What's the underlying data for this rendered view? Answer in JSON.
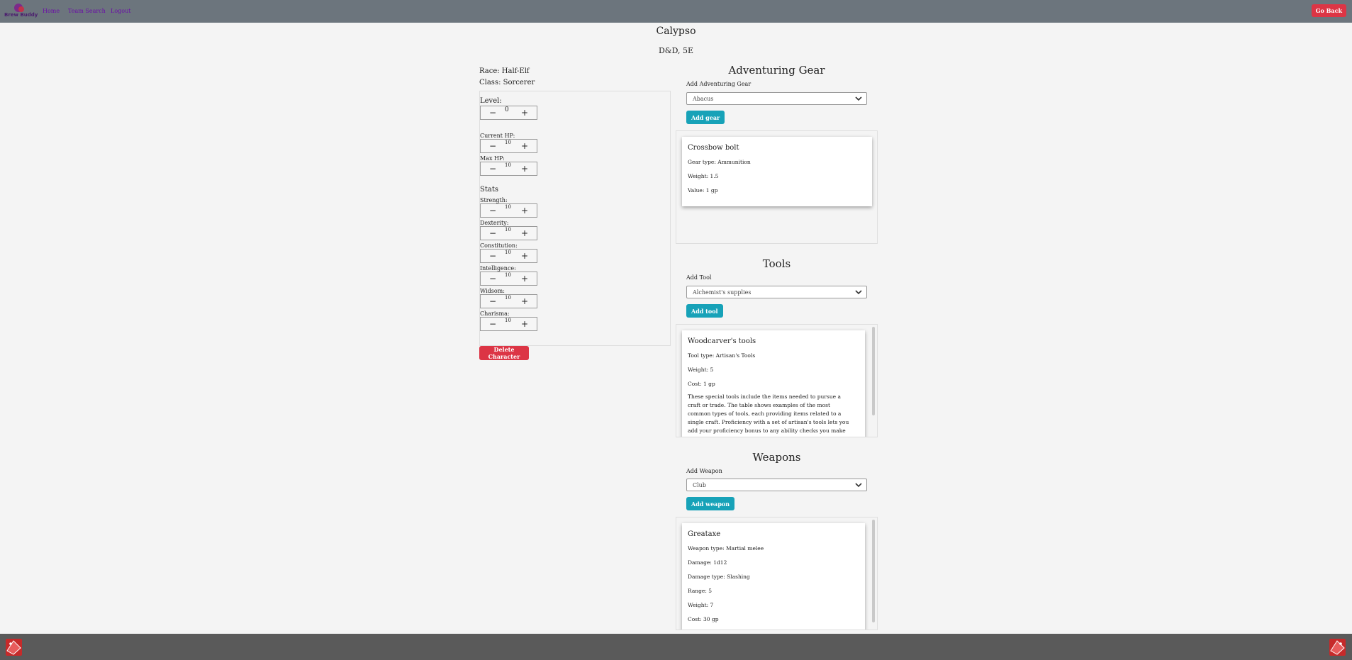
{
  "nav": {
    "logo_text": "Brew Buddy",
    "links": [
      "Home",
      "Team Search",
      "Logout"
    ],
    "go_back": "Go Back"
  },
  "character": {
    "name": "Calypso",
    "game": "D&D, 5E",
    "race": "Race: Half-Elf",
    "class": "Class: Sorcerer"
  },
  "level": {
    "label": "Level:",
    "value": "0"
  },
  "hp": {
    "current_label": "Current HP:",
    "current_value": "10",
    "max_label": "Max HP:",
    "max_value": "10"
  },
  "stats": {
    "title": "Stats",
    "items": [
      {
        "label": "Strength:",
        "value": "10"
      },
      {
        "label": "Dexterity:",
        "value": "10"
      },
      {
        "label": "Constitution:",
        "value": "10"
      },
      {
        "label": "Intelligence:",
        "value": "10"
      },
      {
        "label": "Widsom:",
        "value": "10"
      },
      {
        "label": "Charisma:",
        "value": "10"
      }
    ],
    "minus": "−",
    "plus": "+"
  },
  "delete_button": "Delete Character",
  "gear": {
    "title": "Adventuring Gear",
    "add_label": "Add Adventuring Gear",
    "selected": "Abacus",
    "button": "Add gear",
    "card": {
      "name": "Crossbow bolt",
      "type": "Gear type: Ammunition",
      "weight": "Weight: 1.5",
      "value": "Value: 1 gp"
    }
  },
  "tools": {
    "title": "Tools",
    "add_label": "Add Tool",
    "selected": "Alchemist's supplies",
    "button": "Add tool",
    "card": {
      "name": "Woodcarver's tools",
      "type": "Tool type: Artisan's Tools",
      "weight": "Weight: 5",
      "cost": "Cost: 1 gp",
      "description": "These special tools include the items needed to pursue a craft or trade. The table shows examples of the most common types of tools, each providing items related to a single craft. Proficiency with a set of artisan's tools lets you add your proficiency bonus to any ability checks you make using the tools in your craft. Each type of artisan's"
    }
  },
  "weapons": {
    "title": "Weapons",
    "add_label": "Add Weapon",
    "selected": "Club",
    "button": "Add weapon",
    "card": {
      "name": "Greataxe",
      "type": "Weapon type: Martial melee",
      "damage": "Damage: 1d12",
      "damage_type": "Damage type: Slashing",
      "range": "Range: 5",
      "weight": "Weight: 7",
      "cost": "Cost: 30 gp"
    }
  },
  "colors": {
    "navbar": "#6c757d",
    "footer": "#5a5a5a",
    "danger": "#dc3545",
    "info": "#17a2b8",
    "nav_link": "#6b0ea8"
  },
  "icons": [
    "logo-icon",
    "chevron-down-icon",
    "dice-icon"
  ]
}
